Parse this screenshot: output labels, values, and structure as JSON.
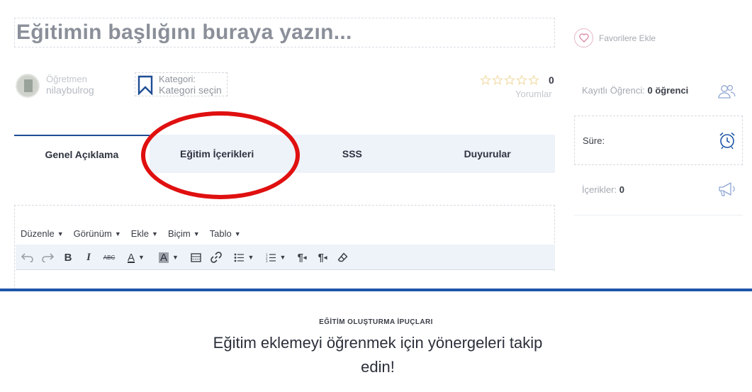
{
  "header": {
    "title": "Eğitimin başlığını buraya yazın..."
  },
  "meta": {
    "teacher_role": "Öğretmen",
    "teacher_name": "nilaybulrog",
    "category_label": "Kategori:",
    "category_select": "Kategori seçin",
    "rating_count": "0",
    "reviews_label": "Yorumlar",
    "star_color": "#f0d9a0"
  },
  "tabs": [
    {
      "label": "Genel Açıklama",
      "active": true
    },
    {
      "label": "Eğitim İçerikleri",
      "active": false
    },
    {
      "label": "SSS",
      "active": false
    },
    {
      "label": "Duyurular",
      "active": false
    }
  ],
  "editor": {
    "menus": [
      "Düzenle",
      "Görünüm",
      "Ekle",
      "Biçim",
      "Tablo"
    ],
    "toolbar": [
      "undo-icon",
      "redo-icon",
      "bold-icon",
      "italic-icon",
      "strikethrough-icon",
      "text-color-icon",
      "background-color-icon",
      "table-icon",
      "link-icon",
      "bullet-list-icon",
      "numbered-list-icon",
      "ltr-icon",
      "rtl-icon",
      "clear-format-icon"
    ]
  },
  "sidebar": {
    "favorite_label": "Favorilere Ekle",
    "enrolled_label": "Kayıtlı Öğrenci:",
    "enrolled_value": "0 öğrenci",
    "duration_label": "Süre:",
    "contents_label": "İçerikler:",
    "contents_value": "0"
  },
  "tips": {
    "overline": "EĞİTİM OLUŞTURMA İPUÇLARI",
    "headline": "Eğitim eklemeyi öğrenmek için yönergeleri takip edin!"
  },
  "colors": {
    "accent": "#1f56a8",
    "tab_bg": "#eef2f9",
    "annotation": "#e01010"
  }
}
